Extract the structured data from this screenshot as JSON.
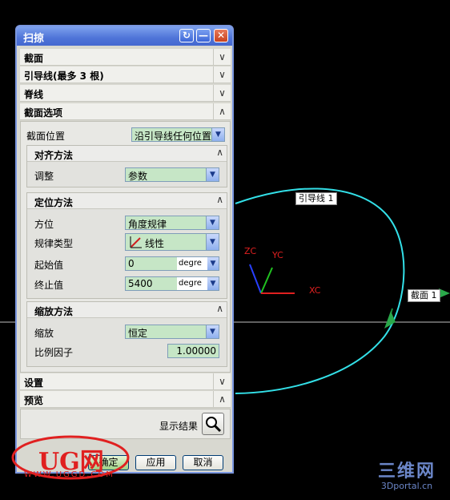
{
  "dialog": {
    "title": "扫掠",
    "title_buttons": {
      "help": "↻",
      "minimize": "—",
      "close": "✕"
    },
    "sections": {
      "section": "截面",
      "guides": "引导线(最多 3 根)",
      "spine": "脊线",
      "section_options": "截面选项",
      "settings": "设置",
      "preview": "预览"
    },
    "section_position": {
      "label": "截面位置",
      "value": "沿引导线任何位置"
    },
    "alignment": {
      "title": "对齐方法",
      "adjust_label": "调整",
      "adjust_value": "参数"
    },
    "orientation": {
      "title": "定位方法",
      "direction_label": "方位",
      "direction_value": "角度规律",
      "law_type_label": "规律类型",
      "law_type_value": "线性",
      "start_label": "起始值",
      "start_value": "0",
      "start_unit": "degre",
      "end_label": "终止值",
      "end_value": "5400",
      "end_unit": "degre"
    },
    "scaling": {
      "title": "缩放方法",
      "scale_label": "缩放",
      "scale_value": "恒定",
      "factor_label": "比例因子",
      "factor_value": "1.00000"
    },
    "show_result_label": "显示结果",
    "buttons": {
      "ok": "确定",
      "apply": "应用",
      "cancel": "取消"
    }
  },
  "viewport": {
    "guide_tag": "引导线 1",
    "section_tag": "截面 1",
    "axis_labels": {
      "zc": "ZC",
      "yc": "YC",
      "xc": "XC"
    },
    "curve_color": "#33e0e8"
  },
  "watermarks": {
    "left_logo": "UG网",
    "left_url": "WWW.UGGD.COM",
    "right_logo": "三维网",
    "right_url": "3Dportal.cn"
  }
}
